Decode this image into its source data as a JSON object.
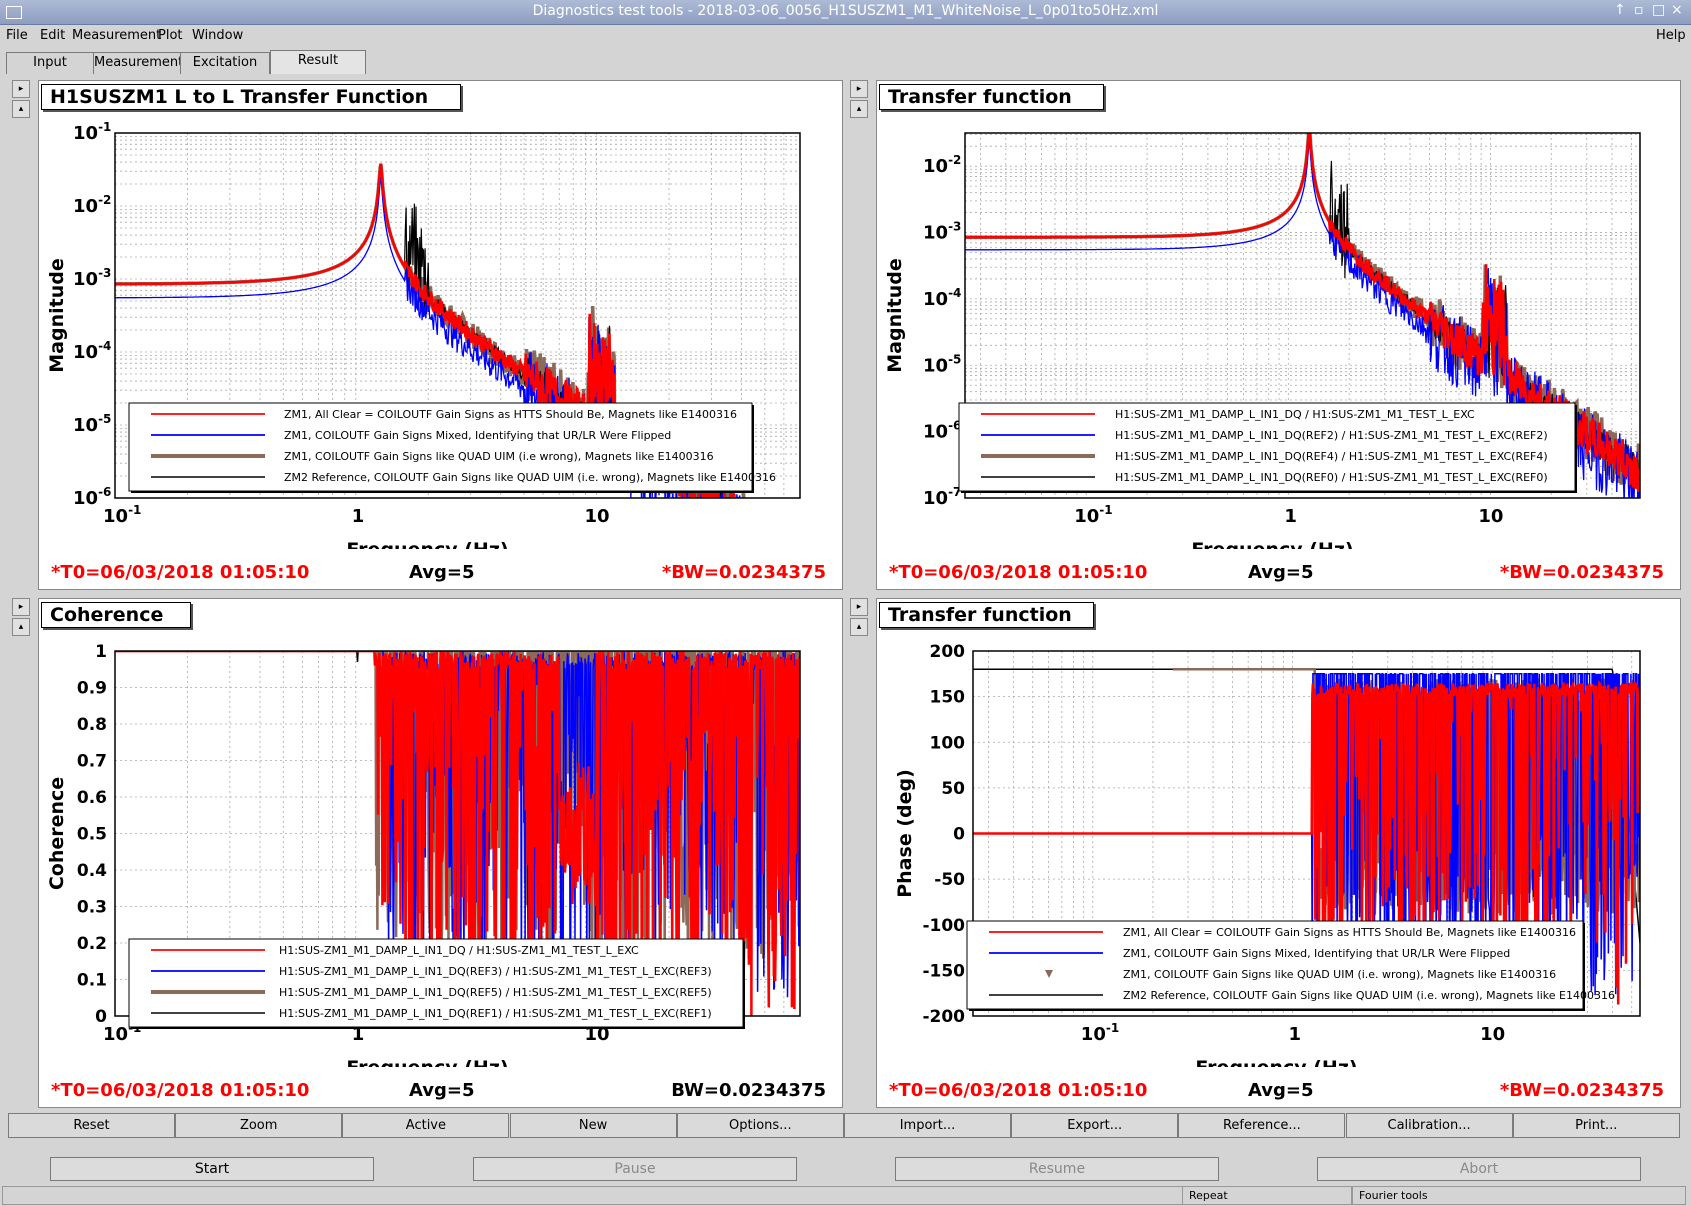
{
  "window": {
    "title": "Diagnostics test tools - 2018-03-06_0056_H1SUSZM1_M1_WhiteNoise_L_0p01to50Hz.xml"
  },
  "menu": {
    "file": "File",
    "edit": "Edit",
    "measurement": "Measurement",
    "plot": "Plot",
    "window": "Window",
    "help": "Help"
  },
  "tabs": [
    "Input",
    "Measurement",
    "Excitation",
    "Result"
  ],
  "panels": {
    "p1": {
      "title": "H1SUSZM1 L to L Transfer Function",
      "ylabel": "Magnitude",
      "xlabel": "Frequency (Hz)",
      "t0": "*T0=06/03/2018 01:05:10",
      "avg": "Avg=5",
      "bw": "*BW=0.0234375",
      "legend": [
        "ZM1, All Clear = COILOUTF Gain Signs as HTTS Should Be, Magnets like E1400316",
        "ZM1, COILOUTF Gain Signs Mixed, Identifying that UR/LR Were Flipped",
        "ZM1, COILOUTF Gain Signs like QUAD UIM (i.e wrong), Magnets like E1400316",
        "ZM2 Reference, COILOUTF Gain Signs like QUAD UIM (i.e. wrong), Magnets like E1400316"
      ]
    },
    "p2": {
      "title": "Transfer function",
      "ylabel": "Magnitude",
      "xlabel": "Frequency (Hz)",
      "t0": "*T0=06/03/2018 01:05:10",
      "avg": "Avg=5",
      "bw": "*BW=0.0234375",
      "legend": [
        "H1:SUS-ZM1_M1_DAMP_L_IN1_DQ / H1:SUS-ZM1_M1_TEST_L_EXC",
        "H1:SUS-ZM1_M1_DAMP_L_IN1_DQ(REF2) / H1:SUS-ZM1_M1_TEST_L_EXC(REF2)",
        "H1:SUS-ZM1_M1_DAMP_L_IN1_DQ(REF4) / H1:SUS-ZM1_M1_TEST_L_EXC(REF4)",
        "H1:SUS-ZM1_M1_DAMP_L_IN1_DQ(REF0) / H1:SUS-ZM1_M1_TEST_L_EXC(REF0)"
      ]
    },
    "p3": {
      "title": "Coherence",
      "ylabel": "Coherence",
      "xlabel": "Frequency (Hz)",
      "t0": "*T0=06/03/2018 01:05:10",
      "avg": "Avg=5",
      "bw": "BW=0.0234375",
      "legend": [
        "H1:SUS-ZM1_M1_DAMP_L_IN1_DQ / H1:SUS-ZM1_M1_TEST_L_EXC",
        "H1:SUS-ZM1_M1_DAMP_L_IN1_DQ(REF3) / H1:SUS-ZM1_M1_TEST_L_EXC(REF3)",
        "H1:SUS-ZM1_M1_DAMP_L_IN1_DQ(REF5) / H1:SUS-ZM1_M1_TEST_L_EXC(REF5)",
        "H1:SUS-ZM1_M1_DAMP_L_IN1_DQ(REF1) / H1:SUS-ZM1_M1_TEST_L_EXC(REF1)"
      ]
    },
    "p4": {
      "title": "Transfer function",
      "ylabel": "Phase (deg)",
      "xlabel": "Frequency (Hz)",
      "t0": "*T0=06/03/2018 01:05:10",
      "avg": "Avg=5",
      "bw": "*BW=0.0234375",
      "legend": [
        "ZM1, All Clear = COILOUTF Gain Signs as HTTS Should Be, Magnets like E1400316",
        "ZM1, COILOUTF Gain Signs Mixed, Identifying that UR/LR Were Flipped",
        "ZM1, COILOUTF Gain Signs like QUAD UIM (i.e. wrong), Magnets like E1400316",
        "ZM2 Reference, COILOUTF Gain Signs like QUAD UIM (i.e. wrong), Magnets like E1400316"
      ]
    }
  },
  "ticks": {
    "x_log": [
      "10",
      "-1",
      "1",
      "10"
    ],
    "p1_y": [
      [
        "10",
        "-1"
      ],
      [
        "10",
        "-2"
      ],
      [
        "10",
        "-3"
      ],
      [
        "10",
        "-4"
      ],
      [
        "10",
        "-5"
      ],
      [
        "10",
        "-6"
      ]
    ],
    "p2_y": [
      [
        "10",
        "-2"
      ],
      [
        "10",
        "-3"
      ],
      [
        "10",
        "-4"
      ],
      [
        "10",
        "-5"
      ],
      [
        "10",
        "-6"
      ],
      [
        "10",
        "-7"
      ]
    ],
    "p3_y": [
      "1",
      "0.9",
      "0.8",
      "0.7",
      "0.6",
      "0.5",
      "0.4",
      "0.3",
      "0.2",
      "0.1",
      "0"
    ],
    "p4_y": [
      "200",
      "150",
      "100",
      "50",
      "0",
      "-50",
      "-100",
      "-150",
      "-200"
    ]
  },
  "buttons": [
    "Reset",
    "Zoom",
    "Active",
    "New",
    "Options...",
    "Import...",
    "Export...",
    "Reference...",
    "Calibration...",
    "Print..."
  ],
  "controls": {
    "start": "Start",
    "pause": "Pause",
    "resume": "Resume",
    "abort": "Abort"
  },
  "status": {
    "repeat": "Repeat",
    "tool": "Fourier tools"
  },
  "colors": {
    "series_a": "#ff0000",
    "series_b": "#0000ff",
    "series_c": "#8b6a5a",
    "series_d": "#000000",
    "footer_red": "#ff0000"
  },
  "chart_data": [
    {
      "type": "line",
      "title": "H1SUSZM1 L to L Transfer Function",
      "xlabel": "Frequency (Hz)",
      "ylabel": "Magnitude",
      "xscale": "log",
      "yscale": "log",
      "xlim": [
        0.1,
        70
      ],
      "ylim": [
        1e-06,
        0.1
      ],
      "x": [
        0.1,
        0.3,
        0.7,
        1.0,
        1.2,
        1.3,
        1.5,
        2.0,
        3.0,
        5.0,
        9.0,
        10,
        20,
        50
      ],
      "series": [
        {
          "name": "ZM1, All Clear = COILOUTF Gain Signs as HTTS Should Be, Magnets like E1400316",
          "values": [
            0.0008,
            0.0009,
            0.0013,
            0.003,
            0.012,
            0.06,
            0.004,
            0.0006,
            0.00015,
            4e-05,
            1e-05,
            0.0002,
            3e-06,
            2e-06
          ]
        },
        {
          "name": "ZM1, COILOUTF Gain Signs Mixed, Identifying that UR/LR Were Flipped",
          "values": [
            0.0005,
            0.0006,
            0.0009,
            0.002,
            0.008,
            0.05,
            0.003,
            0.0004,
            0.0001,
            3e-05,
            1e-05,
            0.0001,
            5e-06,
            1e-05
          ]
        }
      ]
    },
    {
      "type": "line",
      "title": "Coherence",
      "xlabel": "Frequency (Hz)",
      "ylabel": "Coherence",
      "xscale": "log",
      "xlim": [
        0.1,
        50
      ],
      "ylim": [
        0,
        1
      ],
      "x": [
        0.1,
        0.5,
        1.0,
        1.2,
        1.5,
        2.0,
        3.0,
        5.0,
        8.0,
        10,
        20,
        40
      ],
      "series": [
        {
          "name": "H1:SUS-ZM1_M1_DAMP_L_IN1_DQ / H1:SUS-ZM1_M1_TEST_L_EXC",
          "values": [
            1,
            1,
            1,
            0.95,
            0.6,
            0.9,
            0.98,
            0.8,
            0.2,
            0.5,
            0.7,
            0.3
          ]
        }
      ]
    },
    {
      "type": "line",
      "title": "Transfer function",
      "xlabel": "Frequency (Hz)",
      "ylabel": "Phase (deg)",
      "xscale": "log",
      "ylim": [
        -200,
        200
      ],
      "x": [
        0.03,
        0.1,
        0.5,
        1.0,
        1.2,
        1.3,
        2.0,
        5.0,
        10,
        20,
        40
      ],
      "series": [
        {
          "name": "ZM1, All Clear = COILOUTF Gain Signs as HTTS Should Be, Magnets like E1400316",
          "values": [
            0,
            0,
            0,
            0,
            -5,
            175,
            175,
            175,
            170,
            170,
            140
          ]
        }
      ]
    }
  ]
}
